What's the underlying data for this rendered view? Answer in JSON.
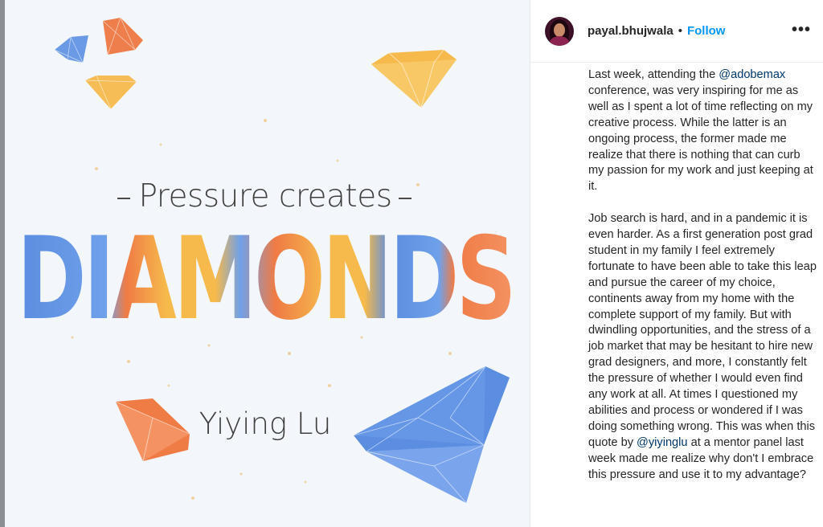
{
  "image": {
    "line1": "Pressure creates",
    "line2": "DIAMONDS",
    "author": "Yiying Lu",
    "colors": {
      "blue": "#5b8de0",
      "orange": "#ef7b45",
      "yellow": "#f6b94c",
      "background": "#f3f6fa"
    }
  },
  "header": {
    "username": "payal.bhujwala",
    "separator": "•",
    "follow_label": "Follow",
    "more_label": "•••"
  },
  "caption": {
    "p1_before": "Last week, attending the ",
    "p1_mention": "@adobemax",
    "p1_after": " conference, was very inspiring for me as well as I spent a lot of time reflecting on my creative process. While the latter is an ongoing process, the former made me realize that there is nothing that can curb my passion for my work and just keeping at it.",
    "p2_before": "Job search is hard, and in a pandemic it is even harder. As a first generation post grad student in my family I feel extremely fortunate to have been able to take this leap and pursue the career of my choice, continents away from my home with the complete support of my family. But with dwindling opportunities, and the stress of a job market that may be hesitant to hire new grad designers, and more, I constantly felt the pressure of whether I would even find any work at all. At times I questioned my abilities and process or wondered if I was doing something wrong. This was when this quote by ",
    "p2_mention": "@yiyinglu",
    "p2_after": " at a mentor panel last week made me realize why don't I embrace this pressure and use it to my advantage?"
  }
}
